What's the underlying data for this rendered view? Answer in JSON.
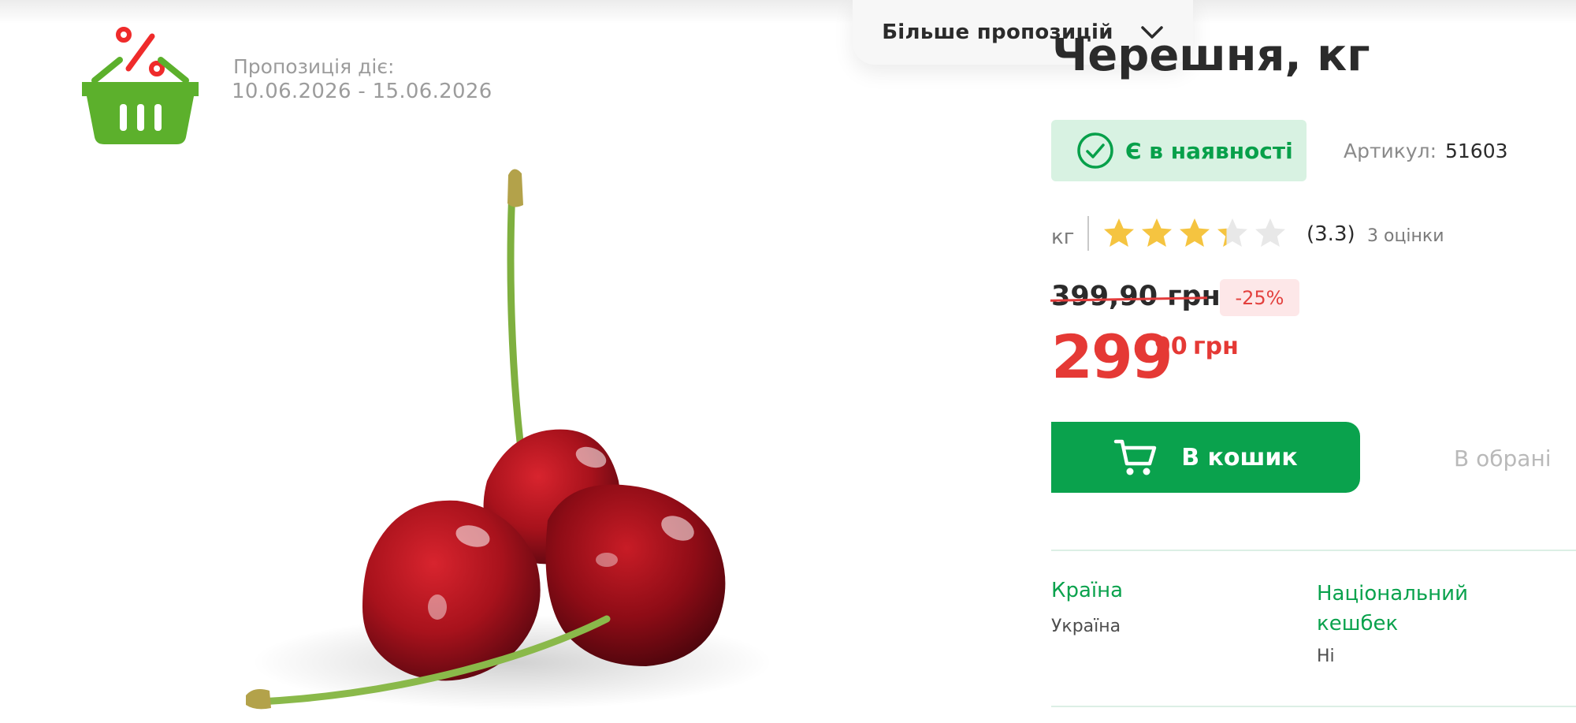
{
  "header": {
    "more_offers_label": "Більше пропозицій",
    "more_offers_icon": "chevron-down-icon"
  },
  "product": {
    "title": "Черешня, кг"
  },
  "promo": {
    "icon": "sale-basket-icon",
    "period_label": "Пропозиція діє:",
    "period_dates": "10.06.2026 - 15.06.2026"
  },
  "availability": {
    "label": "Є в наявності",
    "icon": "check-circle-icon",
    "color": "#07a04a",
    "bg": "#d8f2e2"
  },
  "article": {
    "label": "Артикул:",
    "value": "51603"
  },
  "rating": {
    "unit": "кг",
    "value": 3.3,
    "value_text": "(3.3)",
    "count_text": "3 оцінки",
    "max": 5
  },
  "price": {
    "old": "399,90 грн",
    "discount": "-25%",
    "main": "299",
    "cents": "90",
    "currency": "грн",
    "color": "#e53935"
  },
  "actions": {
    "add_to_cart": "В кошик",
    "cart_icon": "cart-icon",
    "favorites": "В обрані",
    "accent": "#0aa24d"
  },
  "attributes": [
    {
      "label": "Країна",
      "value": "Україна"
    },
    {
      "label": "Національний кешбек",
      "value": "Ні"
    }
  ],
  "image": {
    "subject": "cherries-photo"
  }
}
